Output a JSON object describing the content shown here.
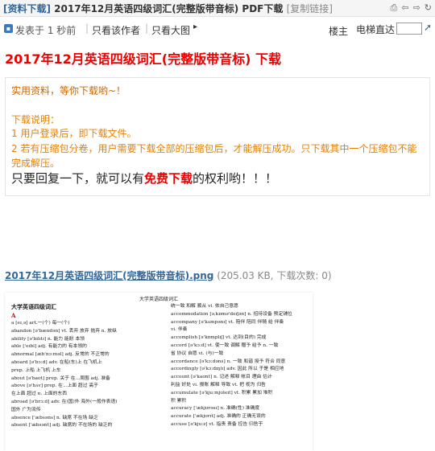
{
  "titlebar": {
    "category": "[资料下载]",
    "title": "2017年12月英语四级词汇(完整版带音标) PDF下载",
    "copy_link": "[复制链接]"
  },
  "icons": [
    "print-icon",
    "back-icon",
    "forward-icon",
    "refresh-icon"
  ],
  "toolbar": {
    "posted": "发表于 1 秒前",
    "author_only": "只看该作者",
    "big_image": "只看大图",
    "floor": "楼主",
    "elevator": "电梯直达"
  },
  "post": {
    "title": "2017年12月英语四级词汇(完整版带音标) 下载",
    "notice_line1": "实用资料，等你下载哟~！",
    "notice_heading": "下载说明：",
    "notice_item1": "1 用户登录后，即下载文件。",
    "notice_item2": "2 若有压缩包分卷，用户需要下载全部的压缩包后，才能解压成功。只下载其中一个压缩包不能完成解压。",
    "reply_prefix": "只要回复一下，就可以有",
    "reply_free": "免费下载",
    "reply_suffix": "的权利哟！！！"
  },
  "attachment": {
    "filename": "2017年12月英语四级词汇(完整版带音标).png",
    "meta": "(205.03 KB, 下载次数: 0)"
  },
  "preview": {
    "header": "大学英语四级词汇",
    "subtitle": "大学英语四级词汇",
    "letter": "A",
    "left_column": [
      "a [eɪ,ə]   art.一(个) 每一(个)",
      "abandon [ə'bændən]   vt. 丢弃 放弃 抛弃 n. 放纵",
      "ability [ə'bɪlɪtɪ]   n. 能力 能耐 本领",
      "able ['eɪbl]   adj. 有能力的 有本领的",
      "abnormal [æb'nɔ:məl]   adj. 反常的 不正常的",
      "aboard [ə'bɔ:d]   adv. 在船(车)上 在飞机上",
      "prep. 上船 上飞机 上车",
      "about [ə'baʊt]   prep. 关于 在...周围 adj. 准备",
      "above [ə'bʌv]   prep. 在...上面 超过 高于",
      "在上面 超过 n. 上面的东西",
      "abroad [ə'brɔ:d]   adv. 在(国)外 海外(一般作表语)",
      "国外 广为流传",
      "absence ['æbsəns]   n. 缺席 不在场 缺乏",
      "absent ['æbsənt]   adj. 缺席的 不在场的 缺乏的"
    ],
    "right_column": [
      "统一致 和解 顺从   vi. 依自己意愿",
      "accommodation [əˌkɒmə'deɪʃən]   n. 招待设备 预定铺位",
      "accompany [ə'kʌmpənɪ]   vt. 陪伴 陪同 伴随 给 伴奏",
      "vi. 伴奏",
      "accomplish [ə'kɒmplɪʃ]   vt. 达到(目的) 完成",
      "accord [ə'kɔ:d]   vt. 使一致 调解 赠予 给予 n. 一致",
      "省 协议 自愿   vi. (与)一致",
      "accordance [ə'kɔ:dəns]   n. 一致 和谐 授予 符合 同意",
      "accordingly [ə'kɔ:dɪŋlɪ]   adv. 因此 所以 于是 相应地",
      "account [ə'kaʊnt]   n. 记述 解释 帐目 理由 估计",
      "利益 好处   vi. 报账 解释 导致   vt. 把 视为 归咎",
      "accumulate [ə'kju:mjʊleɪt]   vt. 积累 累加 堆积",
      "积 累积",
      "accuracy ['ækjʊrəsɪ]   n. 准确(性) 准确度",
      "accurate ['ækjʊrɪt]   adj. 准确的 正确无误的",
      "accuse [ə'kju:z]   vt. 指责 责备 控告 归咎于"
    ]
  }
}
